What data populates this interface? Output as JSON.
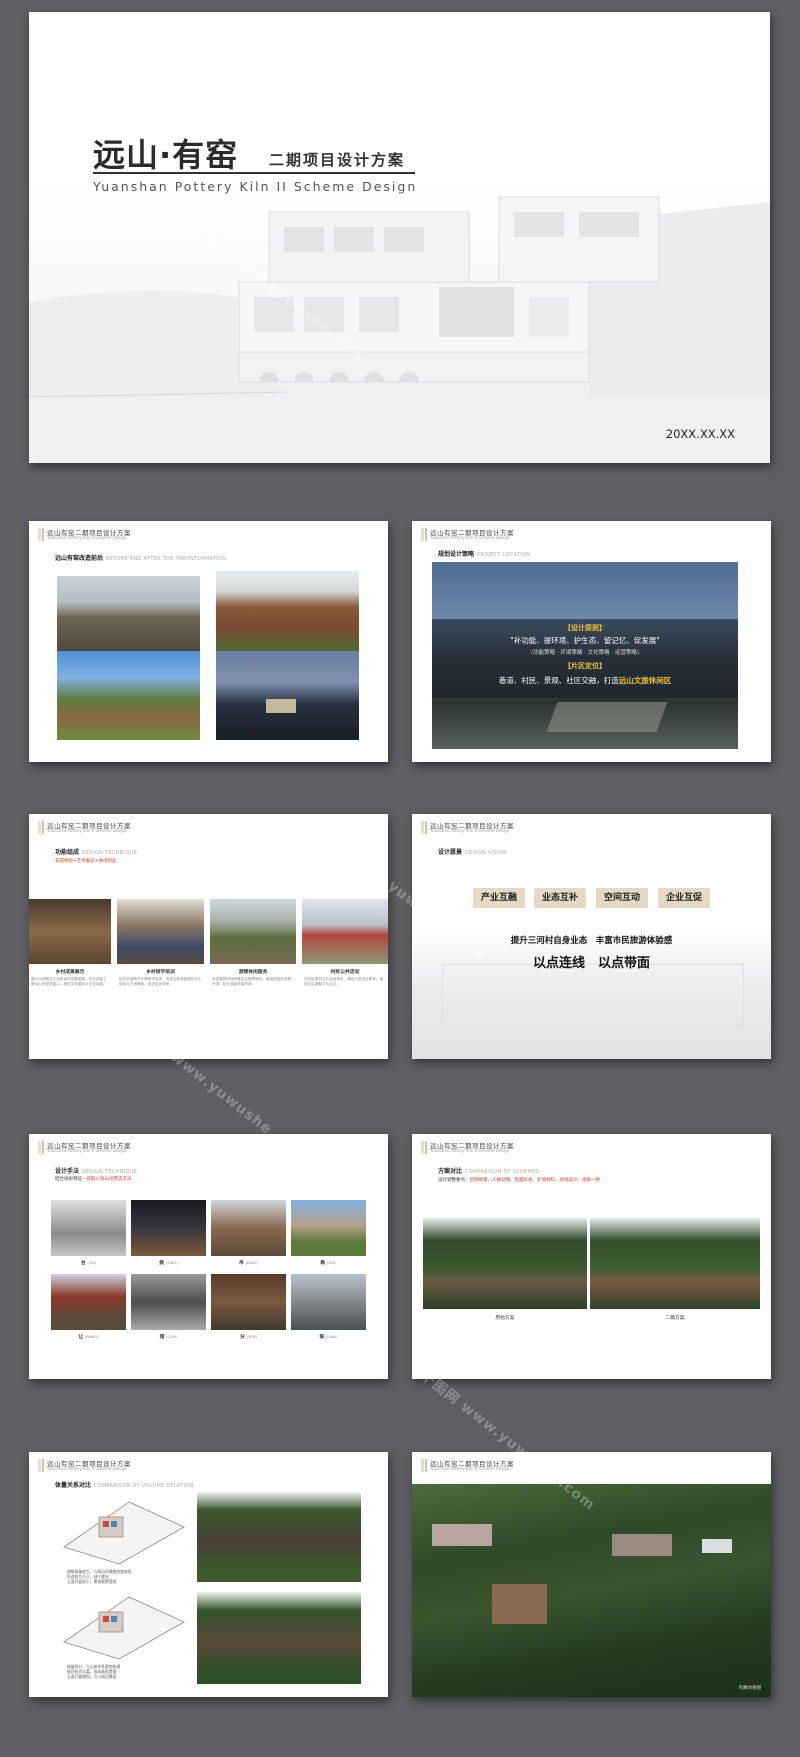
{
  "cover": {
    "title": "远山·有窑",
    "subtitle": "二期项目设计方案",
    "english": "Yuanshan Pottery Kiln II Scheme Design",
    "date": "20XX.XX.XX"
  },
  "header": {
    "cn": "远山有窑二期项目设计方案",
    "en": "Yuanshan Pottery Kiln II Scheme Design"
  },
  "slide2": {
    "section": "远山有窑改造前后",
    "section_en": "BEFORE AND AFTER THE TRANSFORMATION"
  },
  "slide3": {
    "section": "规划设计策略",
    "section_en": "PROJECT LOCATION",
    "label1": "【设计原则】",
    "principle": "\"补功能、提环境、护生态、留记忆、促发展\"",
    "strategies": "(功能策略 · 环境策略 · 文化策略 · 运营策略)",
    "label2": "【片区定位】",
    "position_prefix": "巷道、村民、景观、社区交融，打造",
    "position_highlight": "远山文旅休闲区"
  },
  "slide4": {
    "section": "功能组成",
    "section_en": "DESIGN TECHNIQUE",
    "subtitle": "非遗体验+艺术展览+休闲创业",
    "items": [
      {
        "title": "乡村成果展示",
        "desc": "展示当地陶艺文化和乡村发展成果，作为游客了解远山有窑的窗口，提供文化展览与交流功能。"
      },
      {
        "title": "乡村研学培训",
        "desc": "结合非遗陶艺开展研学培训，为学生和游客提供手工体验与艺术教育，促进文化传承。"
      },
      {
        "title": "游憩休闲服务",
        "desc": "为游客提供休闲餐饮住宿等服务，营造舒适的游憩环境，延长游客停留时间。"
      },
      {
        "title": "村民公共活动",
        "desc": "为村民提供公共活动场所，满足日常交往需求，增强社区凝聚力与活力。"
      }
    ]
  },
  "slide5": {
    "section": "设计愿景",
    "section_en": "DESIGN VISION",
    "tags": [
      "产业互融",
      "业态互补",
      "空间互动",
      "企业互促"
    ],
    "line1": "提升三河村自身业态　丰富市民旅游体验感",
    "line2": "以点连线　以点带面"
  },
  "slide6": {
    "section": "设计手法",
    "section_en": "DESIGN TECHNIQUE",
    "subtitle_prefix": "结合地形特征—",
    "subtitle_highlight": "提取川渝山地营造方法",
    "items": [
      {
        "name": "台",
        "en": "(TAI)"
      },
      {
        "name": "挑",
        "en": "(TIAO)"
      },
      {
        "name": "吊",
        "en": "(DIAO)"
      },
      {
        "name": "跌",
        "en": "(DIE)"
      },
      {
        "name": "让",
        "en": "(RANG)"
      },
      {
        "name": "错",
        "en": "(CUO)"
      },
      {
        "name": "分",
        "en": "(FEN)"
      },
      {
        "name": "联",
        "en": "(LIAN)"
      }
    ]
  },
  "slide7": {
    "section": "方案对比",
    "section_en": "COMPARISON OF SCHEMES",
    "subtitle_prefix": "设计调整要点：",
    "subtitle_highlight": "控制体量、人群动线、屋面形式、外墙材料、场地设计、视角一致",
    "captions": [
      "原始方案",
      "二稿方案"
    ]
  },
  "slide8": {
    "section": "体量关系对比",
    "section_en": "COMPARISON OF VOLUME RELATION",
    "notes_top": [
      "建筑体量较大，与周边环境融合度较低",
      "形态较为方正，缺少变化",
      "立面开窗较少，景观视野受限"
    ],
    "notes_bottom": [
      "体量拆分，与山体关系更加协调",
      "屋顶形式丰富，形成高低错落",
      "立面开窗增加，引入周边景观"
    ]
  },
  "slide9": {
    "caption": "鸟瞰效果图"
  },
  "watermark": "千图网 www.yuwushe.com",
  "colors": {
    "background": "#5f5e63",
    "accent_tag": "#e5d9c6",
    "highlight_yellow": "#f2c230",
    "highlight_red": "#d03a2a"
  }
}
